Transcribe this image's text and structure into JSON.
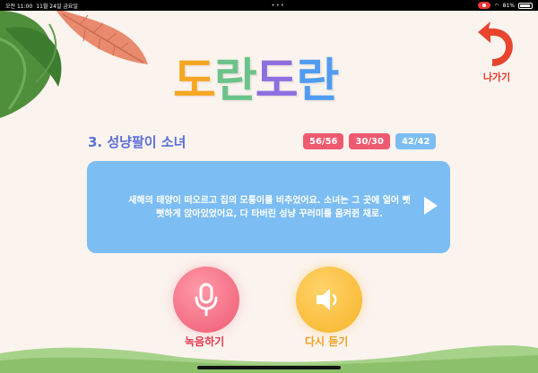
{
  "status_bar": {
    "time": "오전 11:00",
    "date": "11월 24일 금요일",
    "dots": "•••",
    "battery": "81%"
  },
  "title": {
    "chars": [
      "도",
      "란",
      "도",
      "란"
    ],
    "colors": [
      "#f5a623",
      "#6cc38a",
      "#8d6fe0",
      "#4f9cf0"
    ]
  },
  "back_button": {
    "label": "나가기",
    "color": "#e23a2a"
  },
  "story": {
    "title": "3. 성냥팔이 소녀",
    "badges": [
      {
        "text": "56/56",
        "color": "#ee5a6f"
      },
      {
        "text": "30/30",
        "color": "#ee5a6f"
      },
      {
        "text": "42/42",
        "color": "#7cbdf3"
      }
    ],
    "sentence": "새해의 태양이 떠오르고 집의 모퉁이를 비추었어요. 소녀는 그 곳에 얼어 뻣뻣하게 앉아있었어요, 다 타버린 성냥 꾸러미를 움켜쥔 채로."
  },
  "controls": {
    "record_label": "녹음하기",
    "replay_label": "다시 듣기"
  }
}
